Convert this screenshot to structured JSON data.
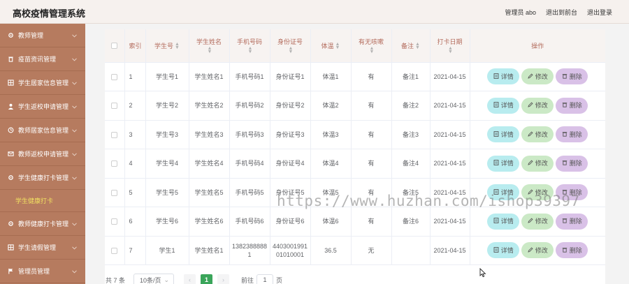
{
  "header": {
    "title": "高校疫情管理系统",
    "user_label": "管理员 abo",
    "to_front_label": "退出到前台",
    "logout_label": "退出登录"
  },
  "sidebar": {
    "items": [
      {
        "label": "教师管理",
        "icon": "gear-icon"
      },
      {
        "label": "疫苗资讯管理",
        "icon": "trash-icon"
      },
      {
        "label": "学生居家信息管理",
        "icon": "grid-icon"
      },
      {
        "label": "学生返校申请管理",
        "icon": "user-icon"
      },
      {
        "label": "教师居家信息管理",
        "icon": "clock-icon"
      },
      {
        "label": "教师返校申请管理",
        "icon": "mail-icon"
      },
      {
        "label": "学生健康打卡管理",
        "icon": "gear-icon"
      }
    ],
    "active_sub": "学生健康打卡",
    "items_after": [
      {
        "label": "教师健康打卡管理",
        "icon": "gear-icon"
      },
      {
        "label": "学生请假管理",
        "icon": "grid-icon"
      },
      {
        "label": "管理员管理",
        "icon": "flag-icon"
      }
    ]
  },
  "table": {
    "headers": {
      "index": "索引",
      "student_no": "学生号",
      "student_name": "学生姓名",
      "phone": "手机号码",
      "id_card": "身份证号",
      "temperature": "体温",
      "cough": "有无咳嗽",
      "remark": "备注",
      "date": "打卡日期",
      "actions": "操作"
    },
    "rows": [
      {
        "index": "1",
        "student_no": "学生号1",
        "student_name": "学生姓名1",
        "phone": "手机号码1",
        "id_card": "身份证号1",
        "temperature": "体温1",
        "cough": "有",
        "remark": "备注1",
        "date": "2021-04-15"
      },
      {
        "index": "2",
        "student_no": "学生号2",
        "student_name": "学生姓名2",
        "phone": "手机号码2",
        "id_card": "身份证号2",
        "temperature": "体温2",
        "cough": "有",
        "remark": "备注2",
        "date": "2021-04-15"
      },
      {
        "index": "3",
        "student_no": "学生号3",
        "student_name": "学生姓名3",
        "phone": "手机号码3",
        "id_card": "身份证号3",
        "temperature": "体温3",
        "cough": "有",
        "remark": "备注3",
        "date": "2021-04-15"
      },
      {
        "index": "4",
        "student_no": "学生号4",
        "student_name": "学生姓名4",
        "phone": "手机号码4",
        "id_card": "身份证号4",
        "temperature": "体温4",
        "cough": "有",
        "remark": "备注4",
        "date": "2021-04-15"
      },
      {
        "index": "5",
        "student_no": "学生号5",
        "student_name": "学生姓名5",
        "phone": "手机号码5",
        "id_card": "身份证号5",
        "temperature": "体温5",
        "cough": "有",
        "remark": "备注5",
        "date": "2021-04-15"
      },
      {
        "index": "6",
        "student_no": "学生号6",
        "student_name": "学生姓名6",
        "phone": "手机号码6",
        "id_card": "身份证号6",
        "temperature": "体温6",
        "cough": "有",
        "remark": "备注6",
        "date": "2021-04-15"
      },
      {
        "index": "7",
        "student_no": "学生1",
        "student_name": "学生姓名1",
        "phone": "13823888881",
        "id_card": "440300199101010001",
        "temperature": "36.5",
        "cough": "无",
        "remark": "",
        "date": "2021-04-15"
      }
    ],
    "actions": {
      "detail": "详情",
      "edit": "修改",
      "delete": "删除"
    }
  },
  "pagination": {
    "total": "共 7 条",
    "page_size": "10条/页",
    "current_page": "1",
    "goto_label": "前往",
    "goto_value": "1",
    "page_suffix": "页"
  },
  "watermark": "https://www.huzhan.com/ishop39397",
  "colors": {
    "sidebar": "#b67b5f",
    "active_sub": "#f1e060",
    "page_active": "#3aa55a",
    "detail": "#b8ecef",
    "edit": "#cbe9c6",
    "delete": "#d9c1e7"
  }
}
